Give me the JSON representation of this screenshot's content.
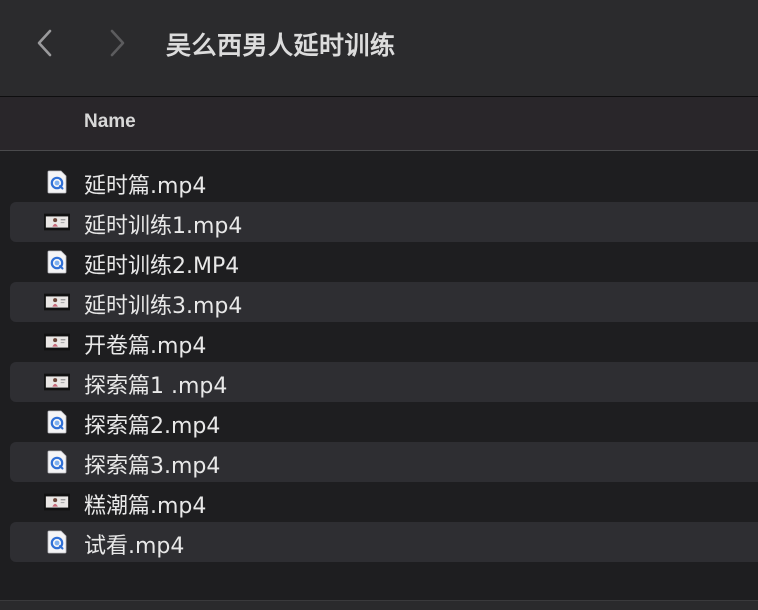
{
  "toolbar": {
    "title": "吴么西男人延时训练",
    "back_icon": "chevron-left-icon",
    "forward_icon": "chevron-right-icon"
  },
  "list_header": {
    "name_label": "Name"
  },
  "files": [
    {
      "name": "延时篇.mp4",
      "icon": "quicktime-file-icon"
    },
    {
      "name": "延时训练1.mp4",
      "icon": "video-thumbnail-icon"
    },
    {
      "name": "延时训练2.MP4",
      "icon": "quicktime-file-icon"
    },
    {
      "name": "延时训练3.mp4",
      "icon": "video-thumbnail-icon"
    },
    {
      "name": "开卷篇.mp4",
      "icon": "video-thumbnail-icon"
    },
    {
      "name": "探索篇1 .mp4",
      "icon": "video-thumbnail-icon"
    },
    {
      "name": "探索篇2.mp4",
      "icon": "quicktime-file-icon"
    },
    {
      "name": "探索篇3.mp4",
      "icon": "quicktime-file-icon"
    },
    {
      "name": "糕潮篇.mp4",
      "icon": "video-thumbnail-icon"
    },
    {
      "name": "试看.mp4",
      "icon": "quicktime-file-icon"
    }
  ],
  "colors": {
    "background": "#1e1e20",
    "toolbar": "#2b2b2d",
    "header": "#29262a",
    "alt_row": "#2e2e32",
    "text": "#e8e8e8"
  }
}
